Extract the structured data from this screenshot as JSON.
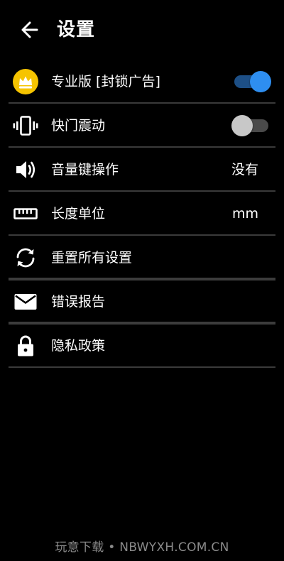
{
  "header": {
    "title": "设置"
  },
  "settings": {
    "pro": {
      "label": "专业版 [封锁广告]",
      "enabled": true,
      "icon": "crown-icon"
    },
    "shutter_vibration": {
      "label": "快门震动",
      "enabled": false,
      "icon": "vibrate-icon"
    },
    "volume_key": {
      "label": "音量键操作",
      "value": "没有",
      "icon": "volume-icon"
    },
    "length_unit": {
      "label": "长度单位",
      "value": "mm",
      "icon": "ruler-icon"
    },
    "reset": {
      "label": "重置所有设置",
      "icon": "reset-icon"
    },
    "bug_report": {
      "label": "错误报告",
      "icon": "mail-icon"
    },
    "privacy": {
      "label": "隐私政策",
      "icon": "lock-icon"
    }
  },
  "watermark": "玩意下载 • NBWYXH.COM.CN",
  "colors": {
    "background": "#000000",
    "accent": "#2e8ef0",
    "accent_track": "#1d4f86",
    "crown_badge": "#f6c400",
    "divider": "#3a3a3a"
  }
}
